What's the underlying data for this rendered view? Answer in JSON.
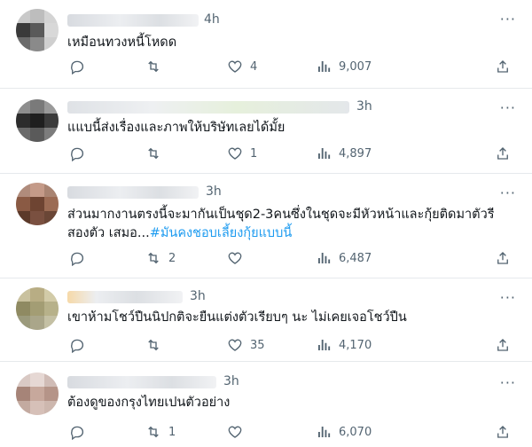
{
  "replies": [
    {
      "time": "4h",
      "text": "เหมือนทวงหนี้โหดด",
      "hashtag": "",
      "reply_count": "",
      "retweet_count": "",
      "like_count": "4",
      "view_count": "9,007"
    },
    {
      "time": "3h",
      "text": "แแบนี้ส่งเรื่องและภาพให้บริษัทเลยได้มั้ย",
      "hashtag": "",
      "reply_count": "",
      "retweet_count": "",
      "like_count": "1",
      "view_count": "4,897"
    },
    {
      "time": "3h",
      "text": "ส่วนมากงานตรงนี้จะมากันเป็นชุด2-3คนซึ่งในชุดจะมีหัวหน้าและกุ้ยติดมาตัวรีสองตัว เสมอ...",
      "hashtag": "#มันคงชอบเลี้ยงกุ้ยแบบนี้",
      "reply_count": "",
      "retweet_count": "2",
      "like_count": "",
      "view_count": "6,487"
    },
    {
      "time": "3h",
      "text": "เขาห้ามโชว์ปืนนิปกติจะยืนแต่งตัวเรียบๆ นะ ไม่เคยเจอโชว์ปืน",
      "hashtag": "",
      "reply_count": "",
      "retweet_count": "",
      "like_count": "35",
      "view_count": "4,170"
    },
    {
      "time": "3h",
      "text": "ต้องดูของกรุงไทยเปนตัวอย่าง",
      "hashtag": "",
      "reply_count": "",
      "retweet_count": "1",
      "like_count": "",
      "view_count": "6,070"
    }
  ],
  "icons": {
    "reply": "reply-icon",
    "retweet": "retweet-icon",
    "like": "heart-icon",
    "views": "views-icon",
    "share": "share-icon",
    "more": "more-icon"
  },
  "colors": {
    "text": "#0f1419",
    "muted": "#536471",
    "link": "#1d9bf0",
    "divider": "#e6e9ec"
  }
}
